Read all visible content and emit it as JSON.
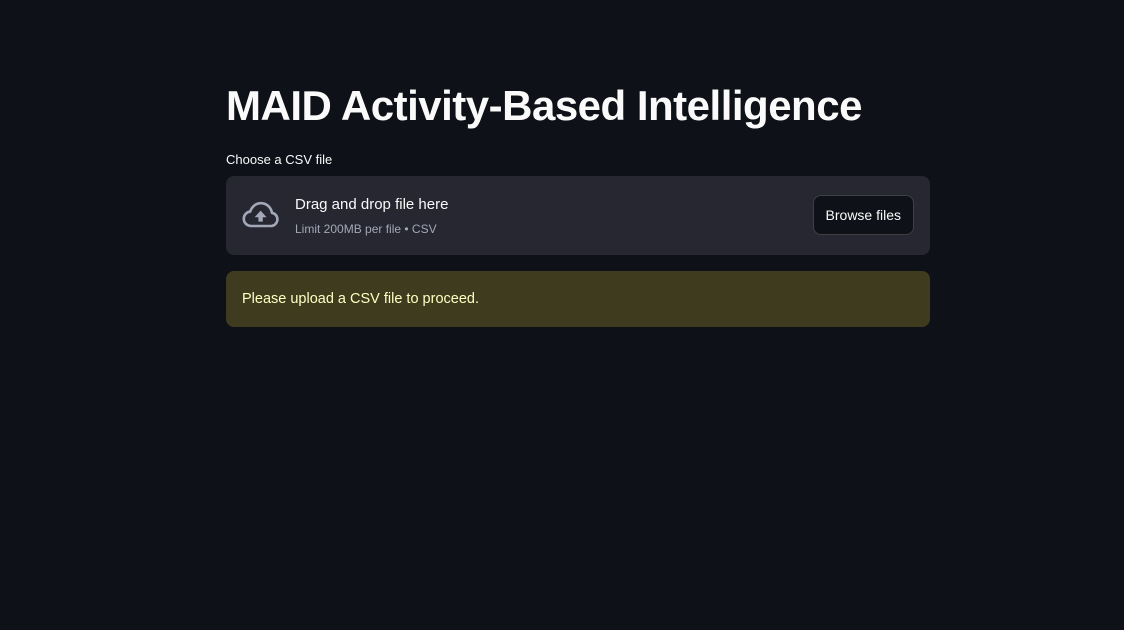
{
  "app": {
    "title": "MAID Activity-Based Intelligence"
  },
  "uploader": {
    "label": "Choose a CSV file",
    "icon": "cloud-upload-icon",
    "instructions": "Drag and drop file here",
    "limit": "Limit 200MB per file • CSV",
    "button_label": "Browse files"
  },
  "alert": {
    "type": "warning",
    "message": "Please upload a CSV file to proceed."
  },
  "colors": {
    "background": "#0e1117",
    "dropzone": "#262730",
    "warning_bg": "#3e3b1f",
    "warning_text": "#ffffc2"
  }
}
